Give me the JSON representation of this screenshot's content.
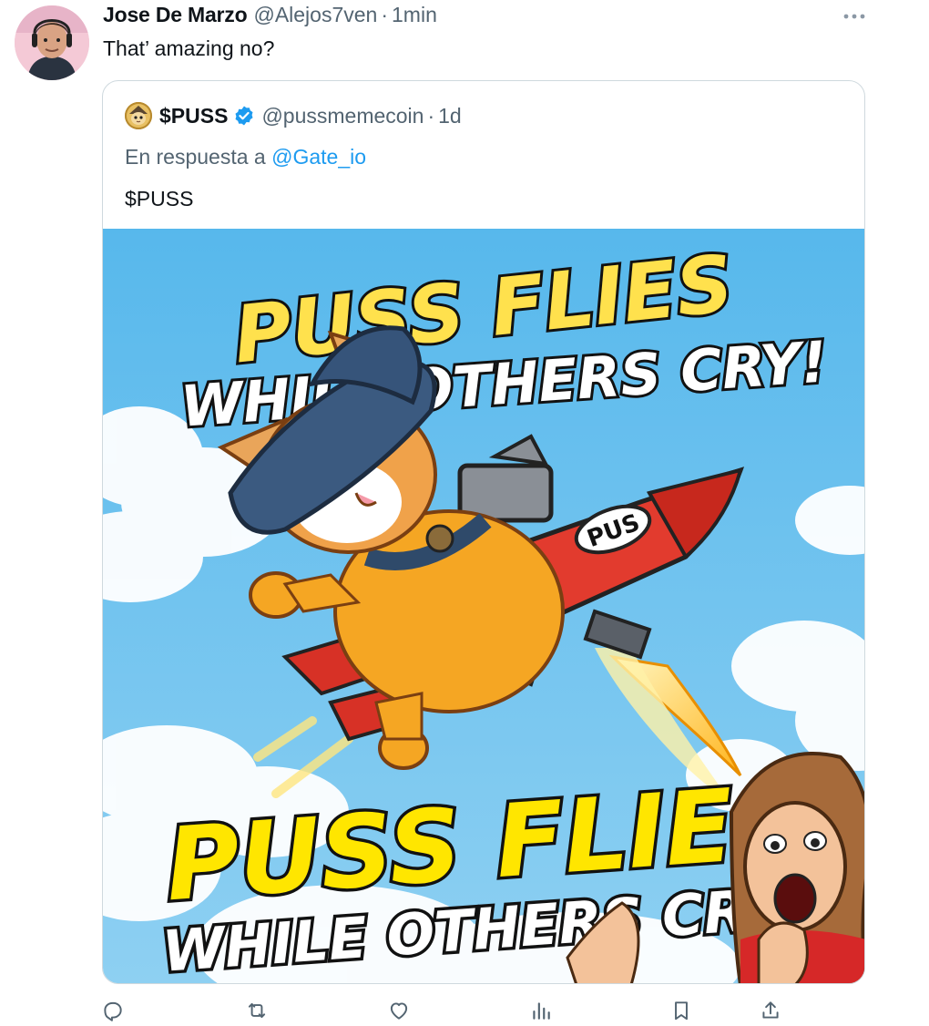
{
  "tweet": {
    "author_name": "Jose De Marzo",
    "handle": "@Alejos7ven",
    "separator": "·",
    "time": "1min",
    "text": "That’ amazing no?"
  },
  "quoted": {
    "author_name": "$PUSS",
    "handle": "@pussmemecoin",
    "separator": "·",
    "time": "1d",
    "reply_prefix": "En respuesta a",
    "reply_to": "@Gate_io",
    "text": "$PUSS",
    "image": {
      "headline_top_line1": "PUSS FLIES",
      "headline_top_line2": "WHILE OTHERS CRY!",
      "headline_bottom_line1": "PUSS FLIES",
      "headline_bottom_line2": "WHILE OTHERS CRY!",
      "rocket_label": "PUS"
    }
  },
  "icons": {
    "more": "more-dots-icon",
    "verified": "verified-badge-icon",
    "reply": "reply-icon",
    "retweet": "retweet-icon",
    "like": "like-icon",
    "views": "views-icon",
    "bookmark": "bookmark-icon",
    "share": "share-icon"
  },
  "colors": {
    "text_primary": "#0f1419",
    "text_secondary": "#536471",
    "link": "#1d9bf0",
    "border": "#cfd9de",
    "verified": "#1d9bf0"
  }
}
